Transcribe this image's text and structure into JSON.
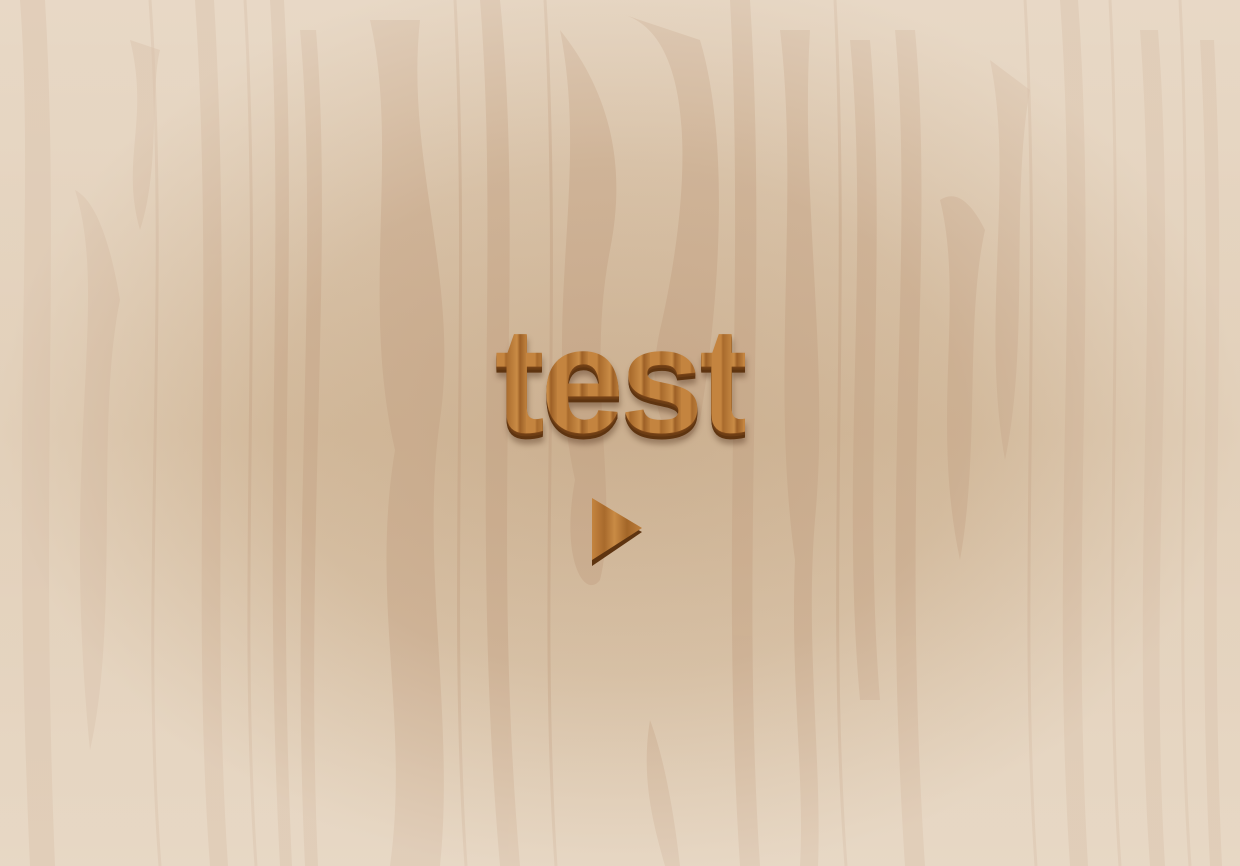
{
  "game": {
    "title": "test"
  },
  "icons": {
    "play": "play-icon"
  },
  "colors": {
    "wood_background": "#d8c4ab",
    "wood_grain": "#c9a98c",
    "title_wood": "#b77a3a",
    "title_shadow": "#6d3d14"
  }
}
